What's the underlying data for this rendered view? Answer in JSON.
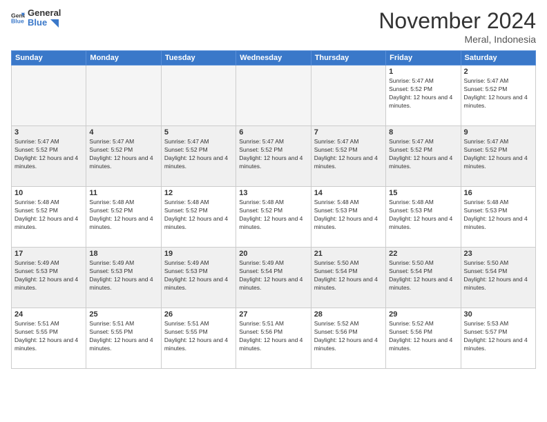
{
  "header": {
    "logo_line1": "General",
    "logo_line2": "Blue",
    "month": "November 2024",
    "location": "Meral, Indonesia"
  },
  "days_of_week": [
    "Sunday",
    "Monday",
    "Tuesday",
    "Wednesday",
    "Thursday",
    "Friday",
    "Saturday"
  ],
  "weeks": [
    [
      {
        "day": "",
        "info": ""
      },
      {
        "day": "",
        "info": ""
      },
      {
        "day": "",
        "info": ""
      },
      {
        "day": "",
        "info": ""
      },
      {
        "day": "",
        "info": ""
      },
      {
        "day": "1",
        "info": "Sunrise: 5:47 AM\nSunset: 5:52 PM\nDaylight: 12 hours and 4 minutes."
      },
      {
        "day": "2",
        "info": "Sunrise: 5:47 AM\nSunset: 5:52 PM\nDaylight: 12 hours and 4 minutes."
      }
    ],
    [
      {
        "day": "3",
        "info": "Sunrise: 5:47 AM\nSunset: 5:52 PM\nDaylight: 12 hours and 4 minutes."
      },
      {
        "day": "4",
        "info": "Sunrise: 5:47 AM\nSunset: 5:52 PM\nDaylight: 12 hours and 4 minutes."
      },
      {
        "day": "5",
        "info": "Sunrise: 5:47 AM\nSunset: 5:52 PM\nDaylight: 12 hours and 4 minutes."
      },
      {
        "day": "6",
        "info": "Sunrise: 5:47 AM\nSunset: 5:52 PM\nDaylight: 12 hours and 4 minutes."
      },
      {
        "day": "7",
        "info": "Sunrise: 5:47 AM\nSunset: 5:52 PM\nDaylight: 12 hours and 4 minutes."
      },
      {
        "day": "8",
        "info": "Sunrise: 5:47 AM\nSunset: 5:52 PM\nDaylight: 12 hours and 4 minutes."
      },
      {
        "day": "9",
        "info": "Sunrise: 5:47 AM\nSunset: 5:52 PM\nDaylight: 12 hours and 4 minutes."
      }
    ],
    [
      {
        "day": "10",
        "info": "Sunrise: 5:48 AM\nSunset: 5:52 PM\nDaylight: 12 hours and 4 minutes."
      },
      {
        "day": "11",
        "info": "Sunrise: 5:48 AM\nSunset: 5:52 PM\nDaylight: 12 hours and 4 minutes."
      },
      {
        "day": "12",
        "info": "Sunrise: 5:48 AM\nSunset: 5:52 PM\nDaylight: 12 hours and 4 minutes."
      },
      {
        "day": "13",
        "info": "Sunrise: 5:48 AM\nSunset: 5:52 PM\nDaylight: 12 hours and 4 minutes."
      },
      {
        "day": "14",
        "info": "Sunrise: 5:48 AM\nSunset: 5:53 PM\nDaylight: 12 hours and 4 minutes."
      },
      {
        "day": "15",
        "info": "Sunrise: 5:48 AM\nSunset: 5:53 PM\nDaylight: 12 hours and 4 minutes."
      },
      {
        "day": "16",
        "info": "Sunrise: 5:48 AM\nSunset: 5:53 PM\nDaylight: 12 hours and 4 minutes."
      }
    ],
    [
      {
        "day": "17",
        "info": "Sunrise: 5:49 AM\nSunset: 5:53 PM\nDaylight: 12 hours and 4 minutes."
      },
      {
        "day": "18",
        "info": "Sunrise: 5:49 AM\nSunset: 5:53 PM\nDaylight: 12 hours and 4 minutes."
      },
      {
        "day": "19",
        "info": "Sunrise: 5:49 AM\nSunset: 5:53 PM\nDaylight: 12 hours and 4 minutes."
      },
      {
        "day": "20",
        "info": "Sunrise: 5:49 AM\nSunset: 5:54 PM\nDaylight: 12 hours and 4 minutes."
      },
      {
        "day": "21",
        "info": "Sunrise: 5:50 AM\nSunset: 5:54 PM\nDaylight: 12 hours and 4 minutes."
      },
      {
        "day": "22",
        "info": "Sunrise: 5:50 AM\nSunset: 5:54 PM\nDaylight: 12 hours and 4 minutes."
      },
      {
        "day": "23",
        "info": "Sunrise: 5:50 AM\nSunset: 5:54 PM\nDaylight: 12 hours and 4 minutes."
      }
    ],
    [
      {
        "day": "24",
        "info": "Sunrise: 5:51 AM\nSunset: 5:55 PM\nDaylight: 12 hours and 4 minutes."
      },
      {
        "day": "25",
        "info": "Sunrise: 5:51 AM\nSunset: 5:55 PM\nDaylight: 12 hours and 4 minutes."
      },
      {
        "day": "26",
        "info": "Sunrise: 5:51 AM\nSunset: 5:55 PM\nDaylight: 12 hours and 4 minutes."
      },
      {
        "day": "27",
        "info": "Sunrise: 5:51 AM\nSunset: 5:56 PM\nDaylight: 12 hours and 4 minutes."
      },
      {
        "day": "28",
        "info": "Sunrise: 5:52 AM\nSunset: 5:56 PM\nDaylight: 12 hours and 4 minutes."
      },
      {
        "day": "29",
        "info": "Sunrise: 5:52 AM\nSunset: 5:56 PM\nDaylight: 12 hours and 4 minutes."
      },
      {
        "day": "30",
        "info": "Sunrise: 5:53 AM\nSunset: 5:57 PM\nDaylight: 12 hours and 4 minutes."
      }
    ]
  ]
}
